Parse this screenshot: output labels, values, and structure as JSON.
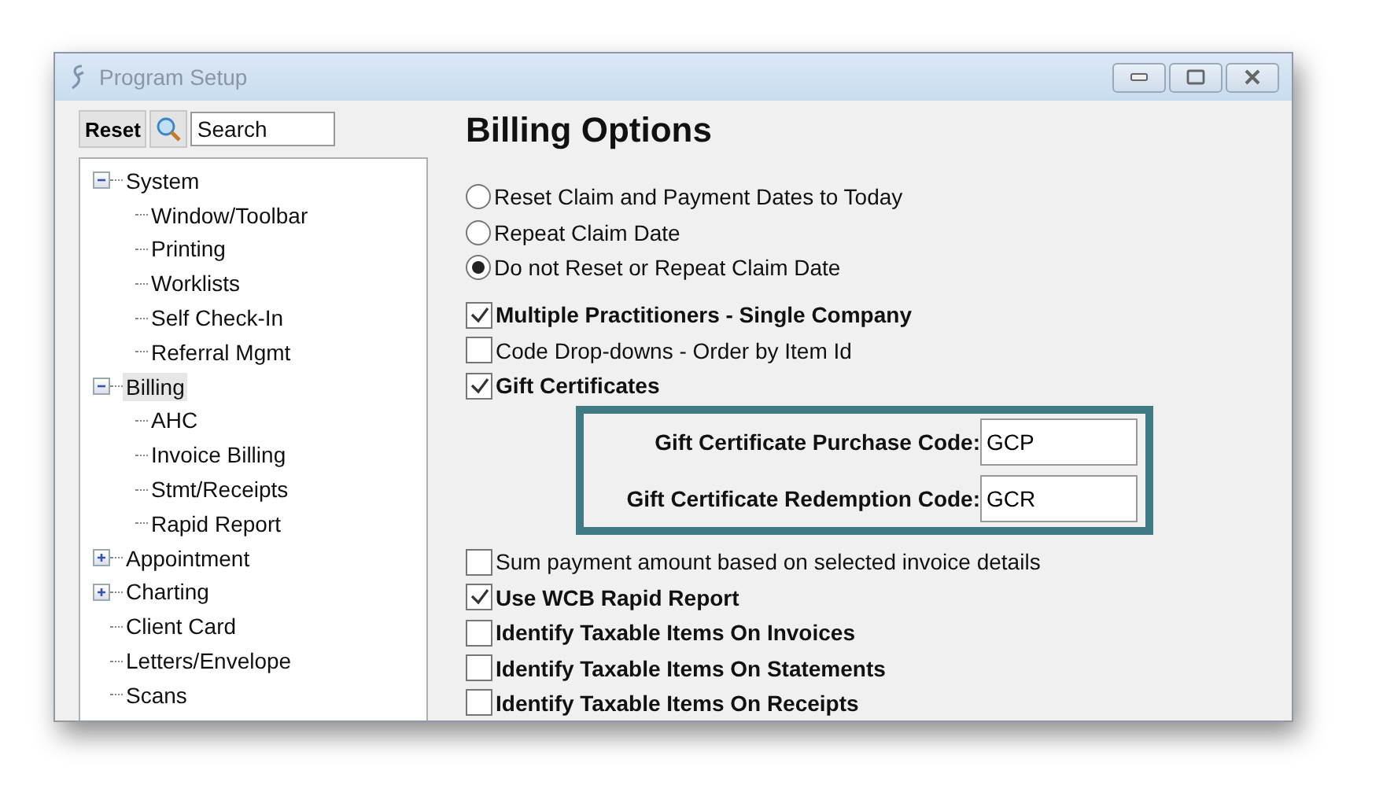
{
  "window": {
    "title": "Program Setup"
  },
  "toolbar": {
    "reset_button": "Reset",
    "search": {
      "placeholder": "Search"
    }
  },
  "tree": [
    {
      "label": "System",
      "kind": "group",
      "expanded": true,
      "selected": false,
      "children": [
        {
          "label": "Window/Toolbar",
          "selected": false
        },
        {
          "label": "Printing",
          "selected": false
        },
        {
          "label": "Worklists",
          "selected": false
        },
        {
          "label": "Self Check-In",
          "selected": false
        },
        {
          "label": "Referral Mgmt",
          "selected": false
        }
      ]
    },
    {
      "label": "Billing",
      "kind": "group",
      "expanded": true,
      "selected": true,
      "children": [
        {
          "label": "AHC",
          "selected": false
        },
        {
          "label": "Invoice Billing",
          "selected": false
        },
        {
          "label": "Stmt/Receipts",
          "selected": false
        },
        {
          "label": "Rapid Report",
          "selected": false
        }
      ]
    },
    {
      "label": "Appointment",
      "kind": "group",
      "expanded": false,
      "selected": false
    },
    {
      "label": "Charting",
      "kind": "group",
      "expanded": false,
      "selected": false
    },
    {
      "label": "Client Card",
      "kind": "leaf",
      "selected": false
    },
    {
      "label": "Letters/Envelope",
      "kind": "leaf",
      "selected": false
    },
    {
      "label": "Scans",
      "kind": "leaf",
      "selected": false
    }
  ],
  "heading": "Billing Options",
  "date_options": [
    {
      "label": "Reset Claim and Payment Dates to Today",
      "selected": false
    },
    {
      "label": "Repeat Claim Date",
      "selected": false
    },
    {
      "label": "Do not Reset or Repeat Claim Date",
      "selected": true
    }
  ],
  "options_top": [
    {
      "label": "Multiple Practitioners - Single Company",
      "checked": true,
      "bold": true
    },
    {
      "label": "Code Drop-downs - Order by Item Id",
      "checked": false,
      "bold": false
    },
    {
      "label": "Gift Certificates",
      "checked": true,
      "bold": true
    }
  ],
  "gift_codes": [
    {
      "label": "Gift Certificate Purchase Code:",
      "value": "GCP"
    },
    {
      "label": "Gift Certificate Redemption Code:",
      "value": "GCR"
    }
  ],
  "options_bottom": [
    {
      "label": "Sum payment amount based on selected invoice details",
      "checked": false,
      "bold": false
    },
    {
      "label": "Use WCB Rapid Report",
      "checked": true,
      "bold": true
    },
    {
      "label": "Identify Taxable Items On Invoices",
      "checked": false,
      "bold": true
    },
    {
      "label": "Identify Taxable Items On Statements",
      "checked": false,
      "bold": true
    },
    {
      "label": "Identify Taxable Items On Receipts",
      "checked": false,
      "bold": true
    }
  ]
}
